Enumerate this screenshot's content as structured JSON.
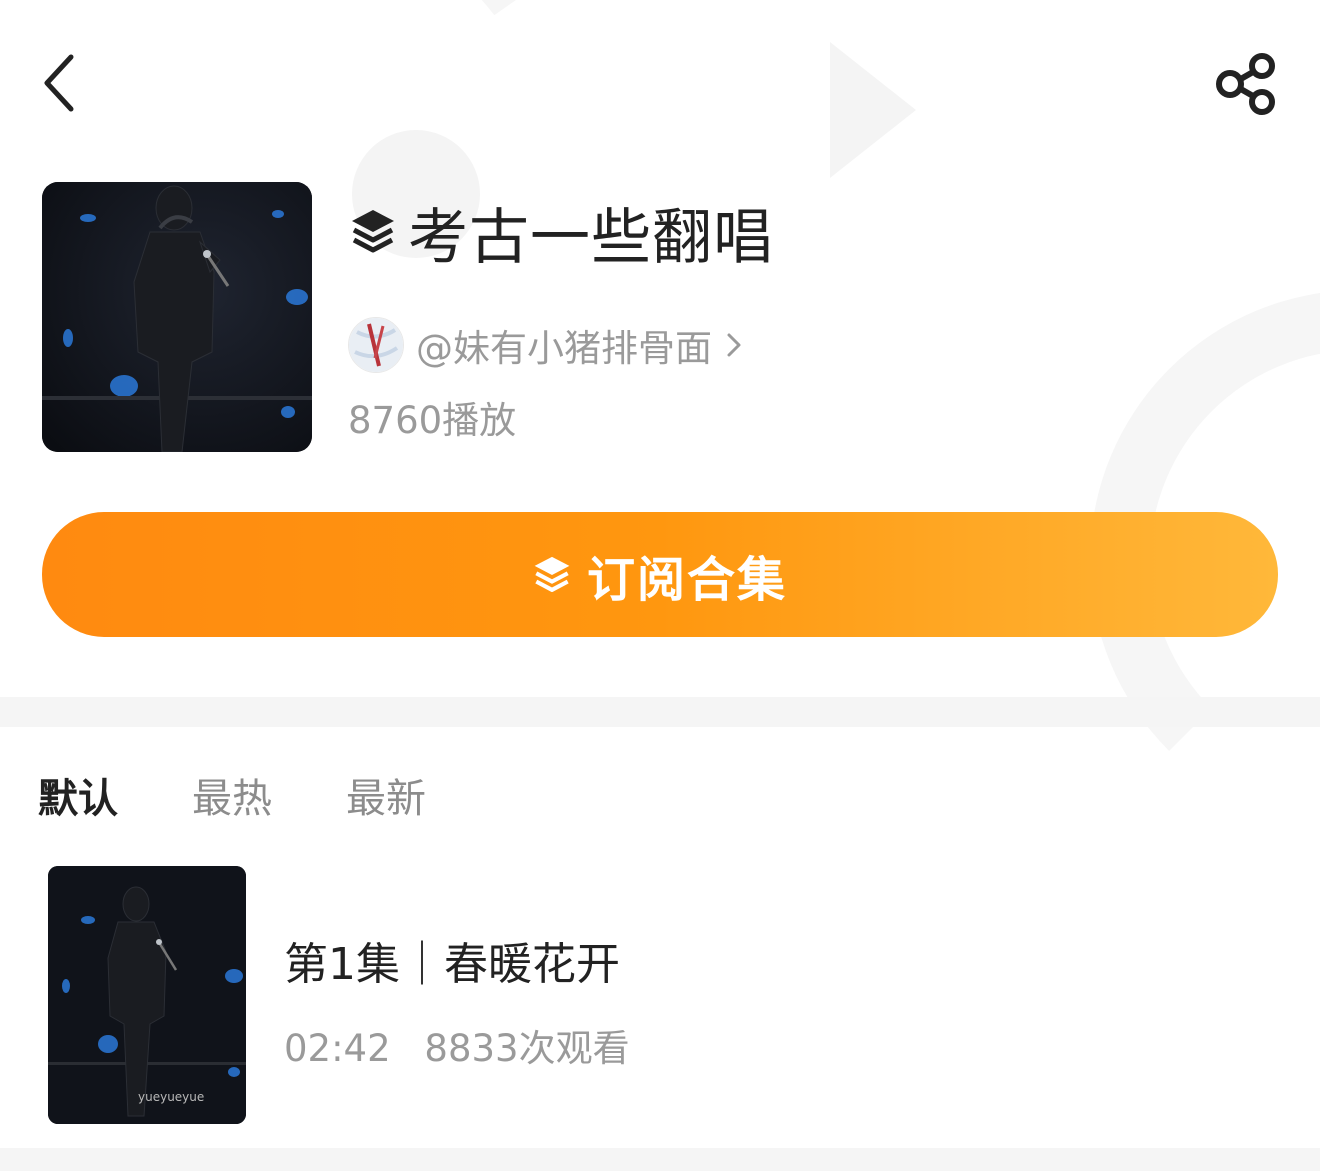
{
  "topbar": {
    "back_icon": "chevron-left-icon",
    "share_icon": "share-icon"
  },
  "collection": {
    "title": "考古一些翻唱",
    "title_icon": "layers-icon",
    "author": "@妹有小猪排骨面",
    "plays": "8760播放"
  },
  "subscribe": {
    "label": "订阅合集",
    "icon": "layers-icon",
    "colors": {
      "start": "#ff8a10",
      "end": "#ffb83a"
    }
  },
  "sort_tabs": [
    {
      "label": "默认",
      "active": true
    },
    {
      "label": "最热",
      "active": false
    },
    {
      "label": "最新",
      "active": false
    }
  ],
  "episodes": [
    {
      "title": "第1集｜春暖花开",
      "duration": "02:42",
      "views": "8833次观看",
      "watermark": "yueyueyue"
    }
  ],
  "colors": {
    "accent": "#ff8a10",
    "text_primary": "#222222",
    "text_secondary": "#9a9a9a"
  }
}
